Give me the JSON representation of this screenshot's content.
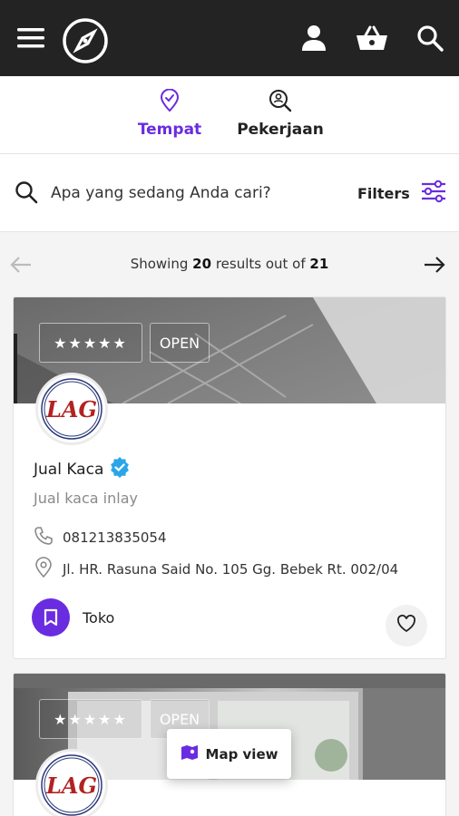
{
  "colors": {
    "accent": "#6a2ce0",
    "topbar": "#232323",
    "verified": "#2aa6e8"
  },
  "header": {
    "icons": [
      "menu-icon",
      "compass-icon",
      "user-icon",
      "basket-icon",
      "search-icon"
    ]
  },
  "tabs": [
    {
      "label": "Tempat",
      "icon": "map-pin-check-icon",
      "active": true
    },
    {
      "label": "Pekerjaan",
      "icon": "search-person-icon",
      "active": false
    }
  ],
  "search": {
    "placeholder": "Apa yang sedang Anda cari?",
    "filters_label": "Filters"
  },
  "pager": {
    "prefix": "Showing",
    "shown": "20",
    "middle": "results out of",
    "total": "21"
  },
  "listings": [
    {
      "rating_stars": "★★★★★",
      "status": "OPEN",
      "logo_text": "LAG",
      "name": "Jual Kaca",
      "verified": true,
      "subtitle": "Jual kaca inlay",
      "phone": "081213835054",
      "address": "Jl. HR. Rasuna Said No. 105 Gg. Bebek Rt. 002/04",
      "category": "Toko"
    },
    {
      "rating_stars": "★★★★★",
      "status": "OPEN",
      "logo_text": "LAG"
    }
  ],
  "map_button": {
    "label": "Map view"
  }
}
